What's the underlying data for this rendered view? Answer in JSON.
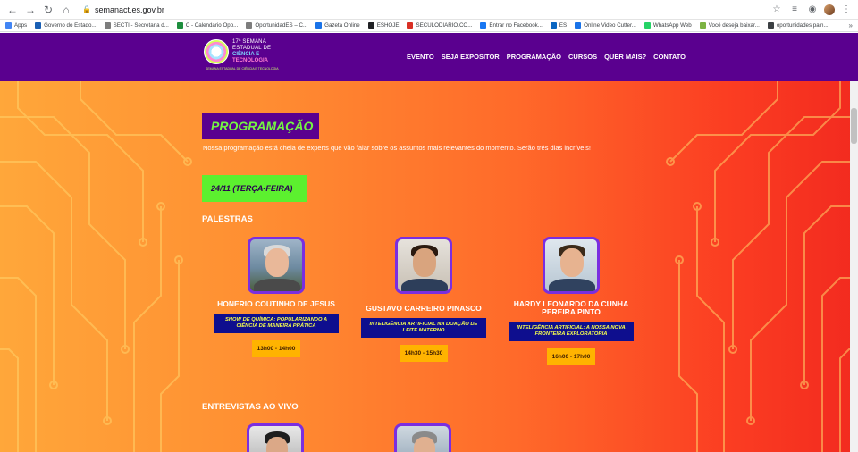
{
  "browser": {
    "url": "semanact.es.gov.br",
    "bookmarks": [
      {
        "label": "Apps",
        "color": "#4285f4"
      },
      {
        "label": "Governo do Estado...",
        "color": "#1a5fb4"
      },
      {
        "label": "SECTI - Secretaria d...",
        "color": "#7d7d7d"
      },
      {
        "label": "C - Calendario Opo...",
        "color": "#1e8e3e"
      },
      {
        "label": "OportunidadES – C...",
        "color": "#7d7d7d"
      },
      {
        "label": "Gazeta Online",
        "color": "#1a73e8"
      },
      {
        "label": "ESHOJE",
        "color": "#202124"
      },
      {
        "label": "SECULODIARIO.CO...",
        "color": "#d93025"
      },
      {
        "label": "Entrar no Facebook...",
        "color": "#1877f2"
      },
      {
        "label": "ES",
        "color": "#0a66c2"
      },
      {
        "label": "Online Video Cutter...",
        "color": "#1a73e8"
      },
      {
        "label": "WhatsApp Web",
        "color": "#25d366"
      },
      {
        "label": "Você deseja baixar...",
        "color": "#7cb342"
      },
      {
        "label": "oportunidades pain...",
        "color": "#3c4043"
      }
    ],
    "more": "»"
  },
  "header": {
    "logo": {
      "line1": "17ª SEMANA",
      "line2": "ESTADUAL DE",
      "line3": "CIÊNCIA E",
      "line4": "TECNOLOGIA",
      "sub": "SEMANA ESTADUAL DE CIÊNCIA E TECNOLOGIA"
    },
    "menu": [
      "EVENTO",
      "SEJA EXPOSITOR",
      "PROGRAMAÇÃO",
      "CURSOS",
      "QUER MAIS?",
      "CONTATO"
    ]
  },
  "main": {
    "title": "PROGRAMAÇÃO",
    "intro": "Nossa programação está cheia de experts que vão falar sobre os assuntos mais relevantes do momento. Serão três dias incríveis!",
    "day": "24/11 (TERÇA-FEIRA)",
    "palestras_label": "PALESTRAS",
    "speakers": [
      {
        "name": "HONERIO COUTINHO DE JESUS",
        "talk": "SHOW DE QUÍMICA: POPULARIZANDO A CIÊNCIA DE MANEIRA PRÁTICA",
        "time": "13h00 - 14h00"
      },
      {
        "name": "GUSTAVO CARREIRO PINASCO",
        "talk": "INTELIGÊNCIA ARTIFICIAL NA DOAÇÃO DE LEITE MATERNO",
        "time": "14h30 - 15h30"
      },
      {
        "name": "HARDY LEONARDO DA CUNHA PEREIRA PINTO",
        "talk": "INTELIGÊNCIA ARTIFICIAL: A NOSSA NOVA FRONTEIRA EXPLORATÓRIA",
        "time": "16h00 - 17h00"
      }
    ],
    "entrevistas_label": "ENTREVISTAS AO VIVO"
  }
}
